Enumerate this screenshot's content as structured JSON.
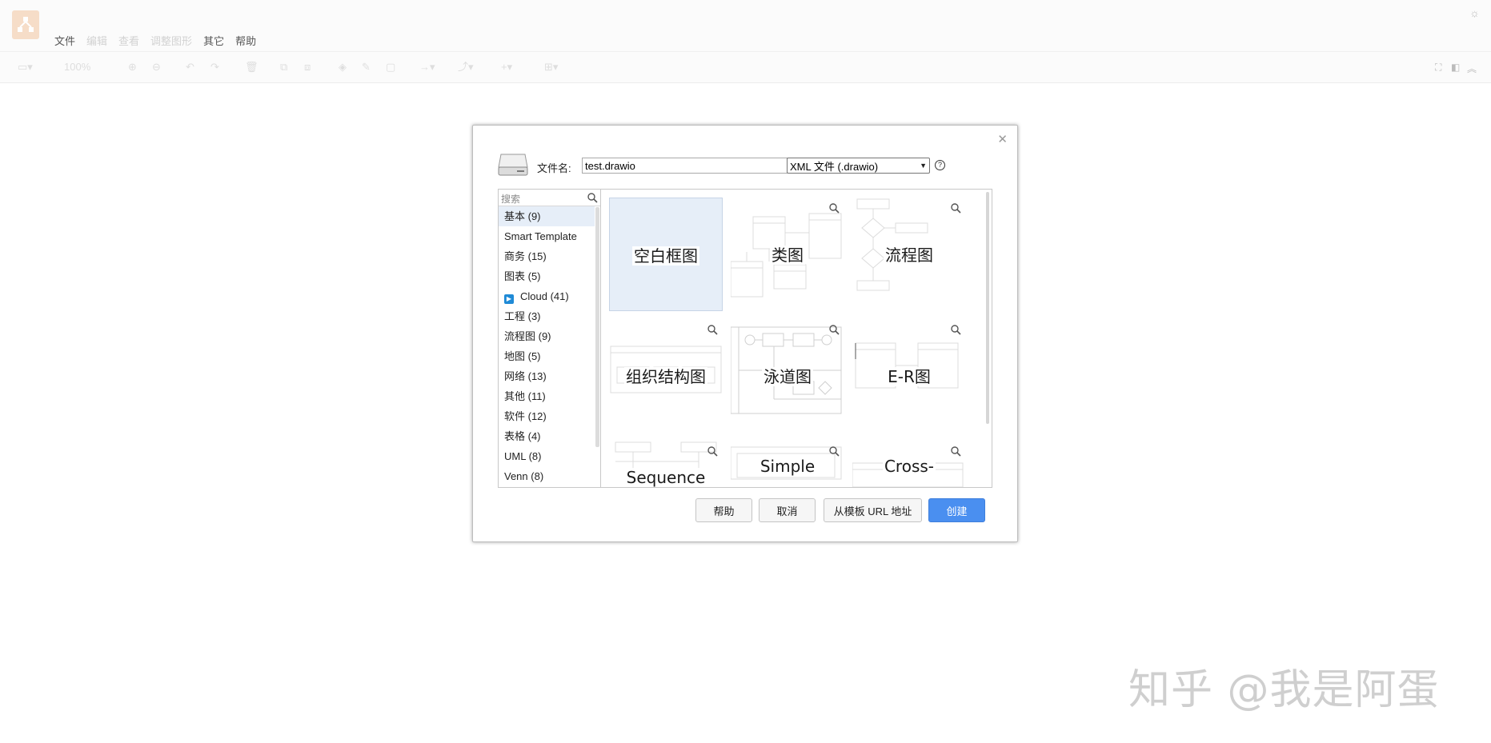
{
  "menubar": {
    "items": [
      {
        "label": "文件",
        "enabled": true
      },
      {
        "label": "编辑",
        "enabled": false
      },
      {
        "label": "查看",
        "enabled": false
      },
      {
        "label": "调整图形",
        "enabled": false
      },
      {
        "label": "其它",
        "enabled": true
      },
      {
        "label": "帮助",
        "enabled": true
      }
    ]
  },
  "toolbar": {
    "zoom": "100%"
  },
  "dialog": {
    "filename_label": "文件名:",
    "filename_value": "test.drawio",
    "format_selected": "XML 文件 (.drawio)",
    "search_placeholder": "搜索",
    "categories": [
      {
        "label": "基本 (9)",
        "selected": true
      },
      {
        "label": "Smart Template"
      },
      {
        "label": "商务 (15)"
      },
      {
        "label": "图表 (5)"
      },
      {
        "label": "Cloud (41)",
        "icon": "play-icon"
      },
      {
        "label": "工程 (3)"
      },
      {
        "label": "流程图 (9)"
      },
      {
        "label": "地图 (5)"
      },
      {
        "label": "网络 (13)"
      },
      {
        "label": "其他 (11)"
      },
      {
        "label": "软件 (12)"
      },
      {
        "label": "表格 (4)"
      },
      {
        "label": "UML (8)"
      },
      {
        "label": "Venn (8)"
      }
    ],
    "templates": [
      {
        "label": "空白框图",
        "selected": true
      },
      {
        "label": "类图"
      },
      {
        "label": "流程图"
      },
      {
        "label": "组织结构图"
      },
      {
        "label": "泳道图"
      },
      {
        "label": "E-R图"
      },
      {
        "label": "Sequence"
      },
      {
        "label": "Simple"
      },
      {
        "label": "Cross-"
      }
    ],
    "buttons": {
      "help": "帮助",
      "cancel": "取消",
      "from_url": "从模板 URL 地址",
      "create": "创建"
    }
  },
  "watermark": "知乎 @我是阿蛋",
  "colors": {
    "primary_button": "#4a8ff0",
    "selected_bg": "#e6eef8",
    "logo_bg": "#f6ddc8"
  }
}
